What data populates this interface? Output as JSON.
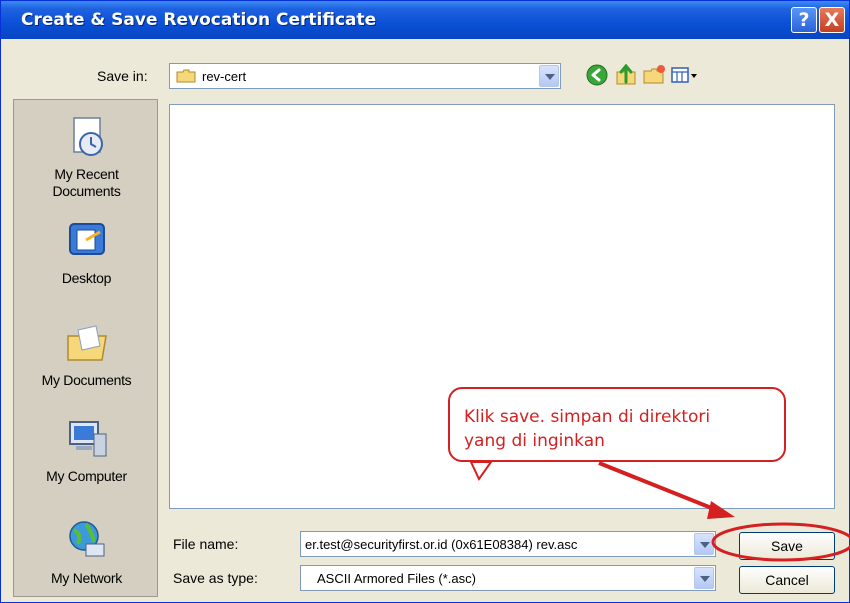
{
  "window": {
    "title": "Create & Save Revocation Certificate"
  },
  "titlebar_buttons": {
    "help": "?",
    "close": "X"
  },
  "toolbar": {
    "save_in_label": "Save in:",
    "save_in_value": "rev-cert",
    "icons": [
      "back-icon",
      "up-folder-icon",
      "new-folder-icon",
      "view-menu-icon"
    ]
  },
  "places": [
    {
      "label": "My Recent Documents",
      "line1": "My Recent",
      "line2": "Documents",
      "icon": "recent-documents-icon"
    },
    {
      "label": "Desktop",
      "line1": "Desktop",
      "line2": "",
      "icon": "desktop-icon"
    },
    {
      "label": "My Documents",
      "line1": "My Documents",
      "line2": "",
      "icon": "my-documents-icon"
    },
    {
      "label": "My Computer",
      "line1": "My Computer",
      "line2": "",
      "icon": "my-computer-icon"
    },
    {
      "label": "My Network",
      "line1": "My Network",
      "line2": "",
      "icon": "my-network-icon"
    }
  ],
  "file_name": {
    "label": "File name:",
    "value": "er.test@securityfirst.or.id (0x61E08384) rev.asc"
  },
  "save_as_type": {
    "label": "Save as type:",
    "value": "ASCII Armored Files (*.asc)"
  },
  "buttons": {
    "save": "Save",
    "cancel": "Cancel"
  },
  "annotation": {
    "line1": "Klik save. simpan di direktori",
    "line2": "yang di inginkan",
    "color": "#d42020"
  },
  "colors": {
    "title_bar": "#0a50d6",
    "dialog_bg": "#ece9d8",
    "places_bg": "#d4cfc0",
    "accent_red": "#d42020"
  }
}
